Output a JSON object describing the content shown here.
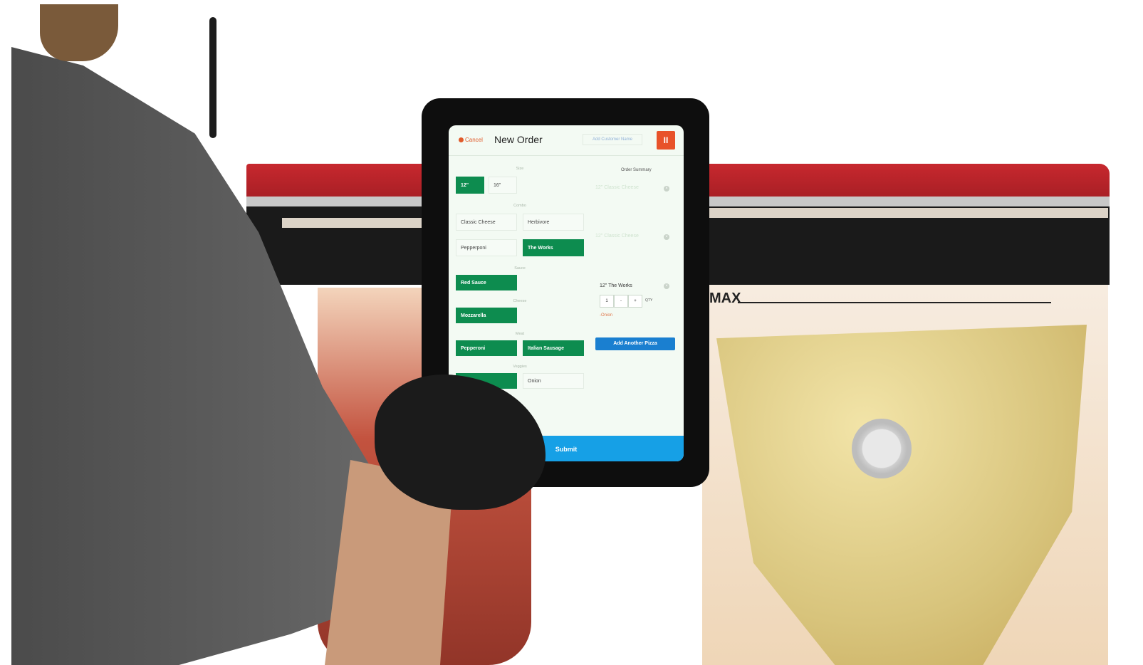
{
  "scene": {
    "machine_label": "MAX"
  },
  "tablet": {
    "header": {
      "cancel_label": "Cancel",
      "title": "New Order",
      "customer_placeholder": "Add Customer Name",
      "pause_icon": "pause-icon",
      "pause_glyph": "II"
    },
    "sections": {
      "size": "Size",
      "combo": "Combo",
      "sauce": "Sauce",
      "cheese": "Cheese",
      "meat": "Meat",
      "veggies": "Veggies"
    },
    "size_options": [
      {
        "label": "12\"",
        "selected": true
      },
      {
        "label": "16\"",
        "selected": false
      }
    ],
    "combo_options": [
      {
        "label": "Classic Cheese",
        "selected": false
      },
      {
        "label": "Herbivore",
        "selected": false
      },
      {
        "label": "Pepperponi",
        "selected": false
      },
      {
        "label": "The Works",
        "selected": true
      }
    ],
    "sauce_options": [
      {
        "label": "Red Sauce",
        "selected": true
      }
    ],
    "cheese_options": [
      {
        "label": "Mozzarella",
        "selected": true
      }
    ],
    "meat_options": [
      {
        "label": "Pepperoni",
        "selected": true
      },
      {
        "label": "Italian Sausage",
        "selected": true
      }
    ],
    "veggie_options": [
      {
        "label": "",
        "selected": true
      },
      {
        "label": "Onion",
        "selected": false
      }
    ],
    "summary": {
      "heading": "Order Summary",
      "faded_items": [
        "12\" Classic Cheese",
        "12\" Classic Cheese"
      ],
      "item": {
        "name": "12\" The Works",
        "quantity": "1",
        "minus": "-",
        "plus": "+",
        "qty_label": "QTY",
        "modifier": "-Onion"
      },
      "remove_glyph": "×",
      "add_button": "Add Another Pizza"
    },
    "submit_label": "Submit"
  },
  "colors": {
    "selected_green": "#0d8c4f",
    "submit_blue": "#16a0e6",
    "pause_orange": "#e8522a",
    "machine_red": "#c7282e"
  }
}
